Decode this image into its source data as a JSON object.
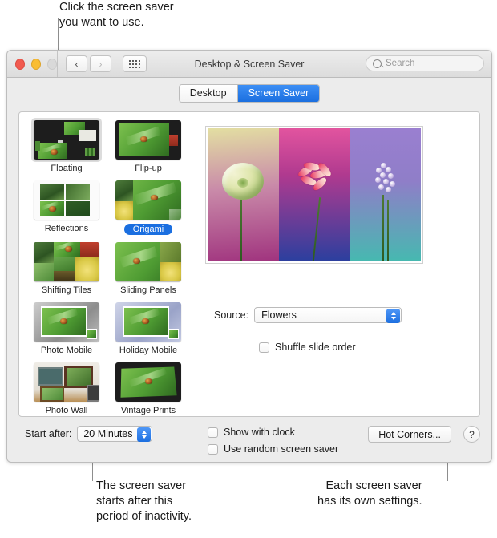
{
  "callouts": {
    "top": "Click the screen saver\nyou want to use.",
    "bottom_left": "The screen saver\nstarts after this\nperiod of inactivity.",
    "bottom_right": "Each screen saver\nhas its own settings."
  },
  "window": {
    "title": "Desktop & Screen Saver",
    "traffic_lights": [
      "close-button",
      "minimize-button",
      "zoom-button"
    ],
    "nav": {
      "back": "‹",
      "forward": "›",
      "grid": "grid-icon"
    },
    "search": {
      "placeholder": "Search",
      "value": ""
    }
  },
  "tabs": [
    {
      "label": "Desktop",
      "active": false
    },
    {
      "label": "Screen Saver",
      "active": true
    }
  ],
  "savers": [
    {
      "label": "Floating",
      "selected_thumb": true,
      "selected_label": false,
      "art": "floating"
    },
    {
      "label": "Flip-up",
      "selected_thumb": false,
      "selected_label": false,
      "art": "flipup"
    },
    {
      "label": "Reflections",
      "selected_thumb": false,
      "selected_label": false,
      "art": "reflections"
    },
    {
      "label": "Origami",
      "selected_thumb": false,
      "selected_label": true,
      "art": "origami"
    },
    {
      "label": "Shifting Tiles",
      "selected_thumb": false,
      "selected_label": false,
      "art": "shifting"
    },
    {
      "label": "Sliding Panels",
      "selected_thumb": false,
      "selected_label": false,
      "art": "sliding"
    },
    {
      "label": "Photo Mobile",
      "selected_thumb": false,
      "selected_label": false,
      "art": "photomobile"
    },
    {
      "label": "Holiday Mobile",
      "selected_thumb": false,
      "selected_label": false,
      "art": "holidaymobile"
    },
    {
      "label": "Photo Wall",
      "selected_thumb": false,
      "selected_label": false,
      "art": "photowall"
    },
    {
      "label": "Vintage Prints",
      "selected_thumb": false,
      "selected_label": false,
      "art": "vintage"
    }
  ],
  "preview": {
    "name": "screen-saver-preview",
    "panels": [
      "pale-green-peony",
      "red-white-lily",
      "purple-white-hyacinth"
    ]
  },
  "settings": {
    "source_label": "Source:",
    "source_value": "Flowers",
    "shuffle_label": "Shuffle slide order",
    "shuffle_checked": false
  },
  "bottom": {
    "start_after_label": "Start after:",
    "start_after_value": "20 Minutes",
    "show_clock_label": "Show with clock",
    "show_clock_checked": false,
    "random_label": "Use random screen saver",
    "random_checked": false,
    "hot_corners_label": "Hot Corners...",
    "help_label": "?"
  },
  "colors": {
    "accent": "#1b6fe0",
    "window_bg": "#ececec",
    "panel_bg": "#ffffff",
    "text": "#1a1a1a"
  }
}
